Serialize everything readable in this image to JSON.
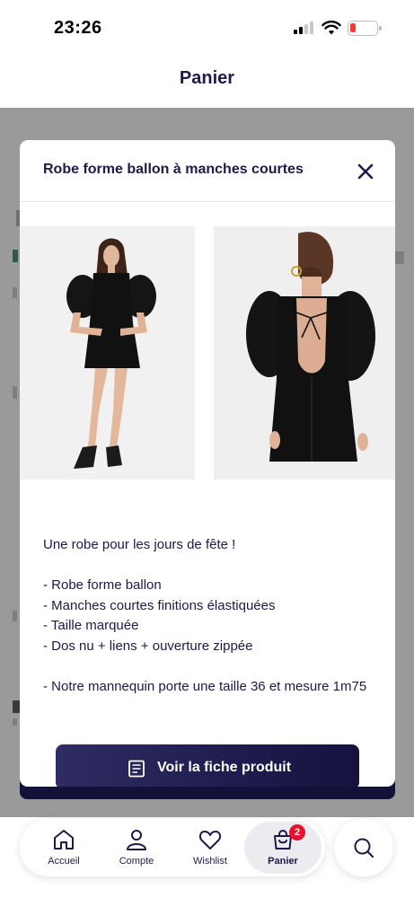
{
  "status_bar": {
    "time": "23:26"
  },
  "header": {
    "title": "Panier"
  },
  "modal": {
    "title": "Robe forme ballon à manches courtes",
    "description": [
      "Une robe pour les jours de fête !",
      "",
      "- Robe forme ballon",
      "- Manches courtes finitions élastiquées",
      "- Taille marquée",
      "- Dos nu + liens + ouverture zippée",
      "",
      "- Notre mannequin porte une taille 36 et mesure 1m75"
    ],
    "product_button_label": "Voir la fiche produit"
  },
  "bottom_nav": {
    "tabs": [
      {
        "label": "Accueil",
        "icon": "home-icon"
      },
      {
        "label": "Compte",
        "icon": "user-icon"
      },
      {
        "label": "Wishlist",
        "icon": "heart-icon"
      },
      {
        "label": "Panier",
        "icon": "bag-icon",
        "active": true,
        "badge": "2"
      }
    ],
    "search_icon": "search-icon"
  },
  "colors": {
    "brand_navy": "#1d1a4a",
    "badge_red": "#e4132e",
    "battery_low": "#ff3b30"
  }
}
